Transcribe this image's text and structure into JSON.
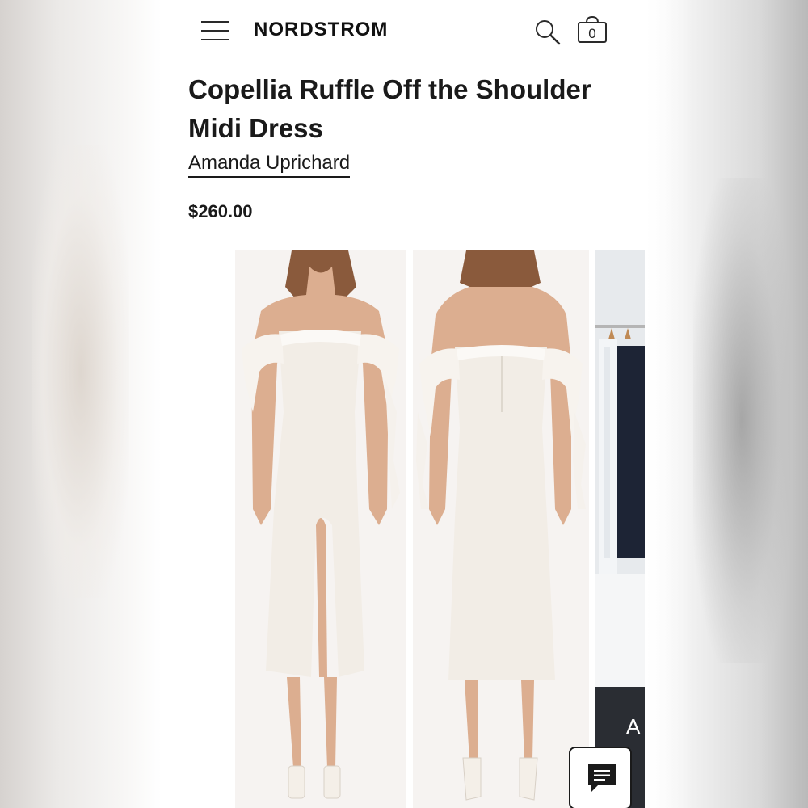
{
  "header": {
    "menu_icon": "hamburger-menu-icon",
    "logo": "NORDSTROM",
    "search_icon": "search-icon",
    "bag_icon": "shopping-bag-icon",
    "bag_count": "0"
  },
  "product": {
    "title": "Copellia Ruffle Off the Shoulder Midi Dress",
    "brand": "Amanda Uprichard",
    "price": "$260.00"
  },
  "gallery": {
    "images": [
      {
        "name": "dress-front-photo"
      },
      {
        "name": "dress-back-photo"
      },
      {
        "name": "store-rack-photo"
      }
    ],
    "peek_text": "A"
  },
  "chat": {
    "icon": "chat-bubble-icon"
  },
  "colors": {
    "text": "#1a1a1a",
    "dress": "#f3efe9",
    "skin": "#d9a98c",
    "hair": "#8a5a3c"
  }
}
